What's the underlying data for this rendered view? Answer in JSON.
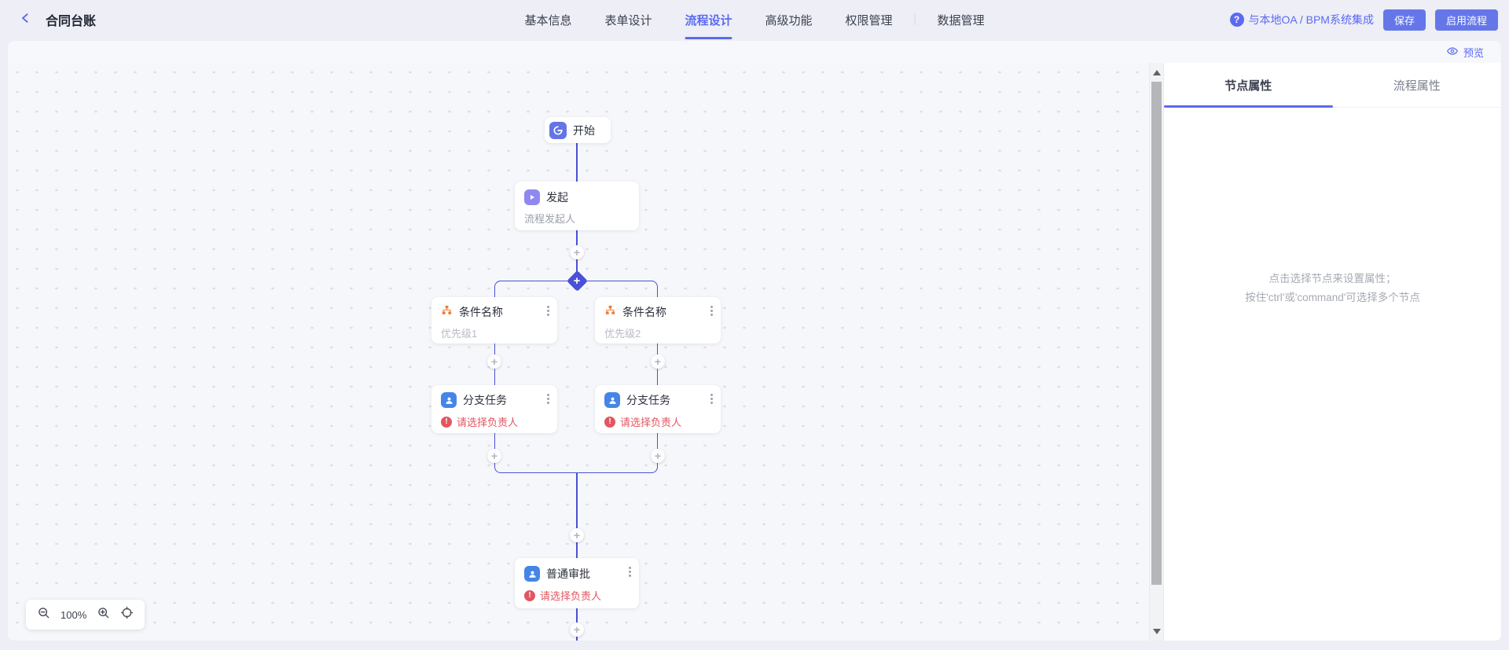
{
  "header": {
    "title": "合同台账",
    "tabs": [
      {
        "label": "基本信息"
      },
      {
        "label": "表单设计"
      },
      {
        "label": "流程设计"
      },
      {
        "label": "高级功能"
      },
      {
        "label": "权限管理"
      },
      {
        "label": "数据管理"
      }
    ],
    "active_tab": "流程设计",
    "integration_link": "与本地OA / BPM系统集成",
    "save_button": "保存",
    "enable_button": "启用流程"
  },
  "toolbar": {
    "preview": "预览"
  },
  "flow": {
    "start": {
      "title": "开始"
    },
    "initiate": {
      "title": "发起",
      "subtitle": "流程发起人"
    },
    "conditions": [
      {
        "title": "条件名称",
        "subtitle": "优先级1"
      },
      {
        "title": "条件名称",
        "subtitle": "优先级2"
      }
    ],
    "tasks": [
      {
        "title": "分支任务",
        "warning": "请选择负责人"
      },
      {
        "title": "分支任务",
        "warning": "请选择负责人"
      }
    ],
    "approval": {
      "title": "普通审批",
      "warning": "请选择负责人"
    },
    "add_symbol": "+",
    "warning_symbol": "!",
    "zoom_level": "100%"
  },
  "panel": {
    "tabs": [
      {
        "label": "节点属性"
      },
      {
        "label": "流程属性"
      }
    ],
    "active_tab": "节点属性",
    "placeholder_line1": "点击选择节点来设置属性；",
    "placeholder_line2": "按住'ctrl'或'command'可选择多个节点"
  },
  "icons": {
    "back": "chevron-left-icon",
    "help": "question-circle-icon",
    "preview": "eye-icon",
    "start": "power-icon",
    "initiate": "play-icon",
    "condition": "branch-icon",
    "task": "person-icon",
    "menu": "kebab-menu-icon",
    "zoom_out": "magnifier-minus-icon",
    "zoom_in": "magnifier-plus-icon",
    "fit": "crosshair-icon"
  },
  "colors": {
    "accent": "#5b6af0",
    "button": "#6577e8",
    "flow_line": "#4a51d6",
    "warning": "#e25661",
    "start_icon": "#6374e8",
    "initiate_icon": "#8f88f0",
    "task_icon": "#4585e8",
    "condition_icon": "#ee7b2e",
    "page_bg": "#edeef6",
    "canvas_bg": "#f6f7fa"
  }
}
